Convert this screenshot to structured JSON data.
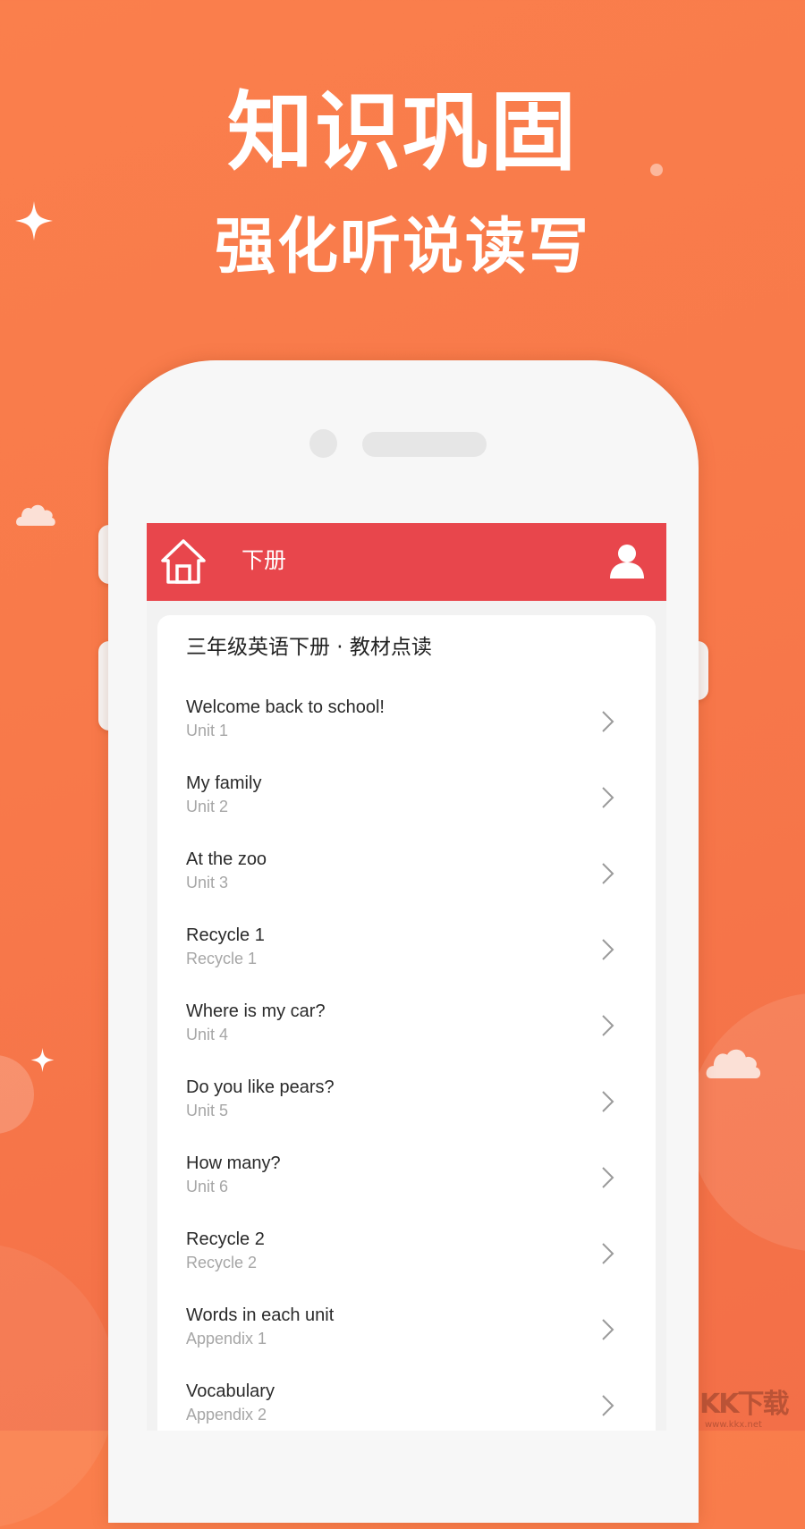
{
  "promo": {
    "headline": "知识巩固",
    "subheadline": "强化听说读写"
  },
  "colors": {
    "background": "#f8794a",
    "appbar": "#e8464c",
    "card": "#ffffff",
    "item_title": "#2a2a2a",
    "item_subtitle": "#a6a6a6"
  },
  "appbar": {
    "home_icon": "home-icon",
    "title": "下册",
    "user_icon": "user-icon"
  },
  "card": {
    "title": "三年级英语下册 · 教材点读",
    "items": [
      {
        "title": "Welcome back to school!",
        "subtitle": "Unit 1"
      },
      {
        "title": "My family",
        "subtitle": "Unit 2"
      },
      {
        "title": "At the zoo",
        "subtitle": "Unit 3"
      },
      {
        "title": "Recycle 1",
        "subtitle": "Recycle 1"
      },
      {
        "title": "Where is my car?",
        "subtitle": "Unit 4"
      },
      {
        "title": "Do you like pears?",
        "subtitle": "Unit 5"
      },
      {
        "title": "How many?",
        "subtitle": "Unit 6"
      },
      {
        "title": "Recycle 2",
        "subtitle": "Recycle 2"
      },
      {
        "title": "Words in each unit",
        "subtitle": "Appendix 1"
      },
      {
        "title": "Vocabulary",
        "subtitle": "Appendix 2"
      }
    ]
  },
  "watermark": {
    "logo": "KK下载",
    "url": "www.kkx.net"
  }
}
